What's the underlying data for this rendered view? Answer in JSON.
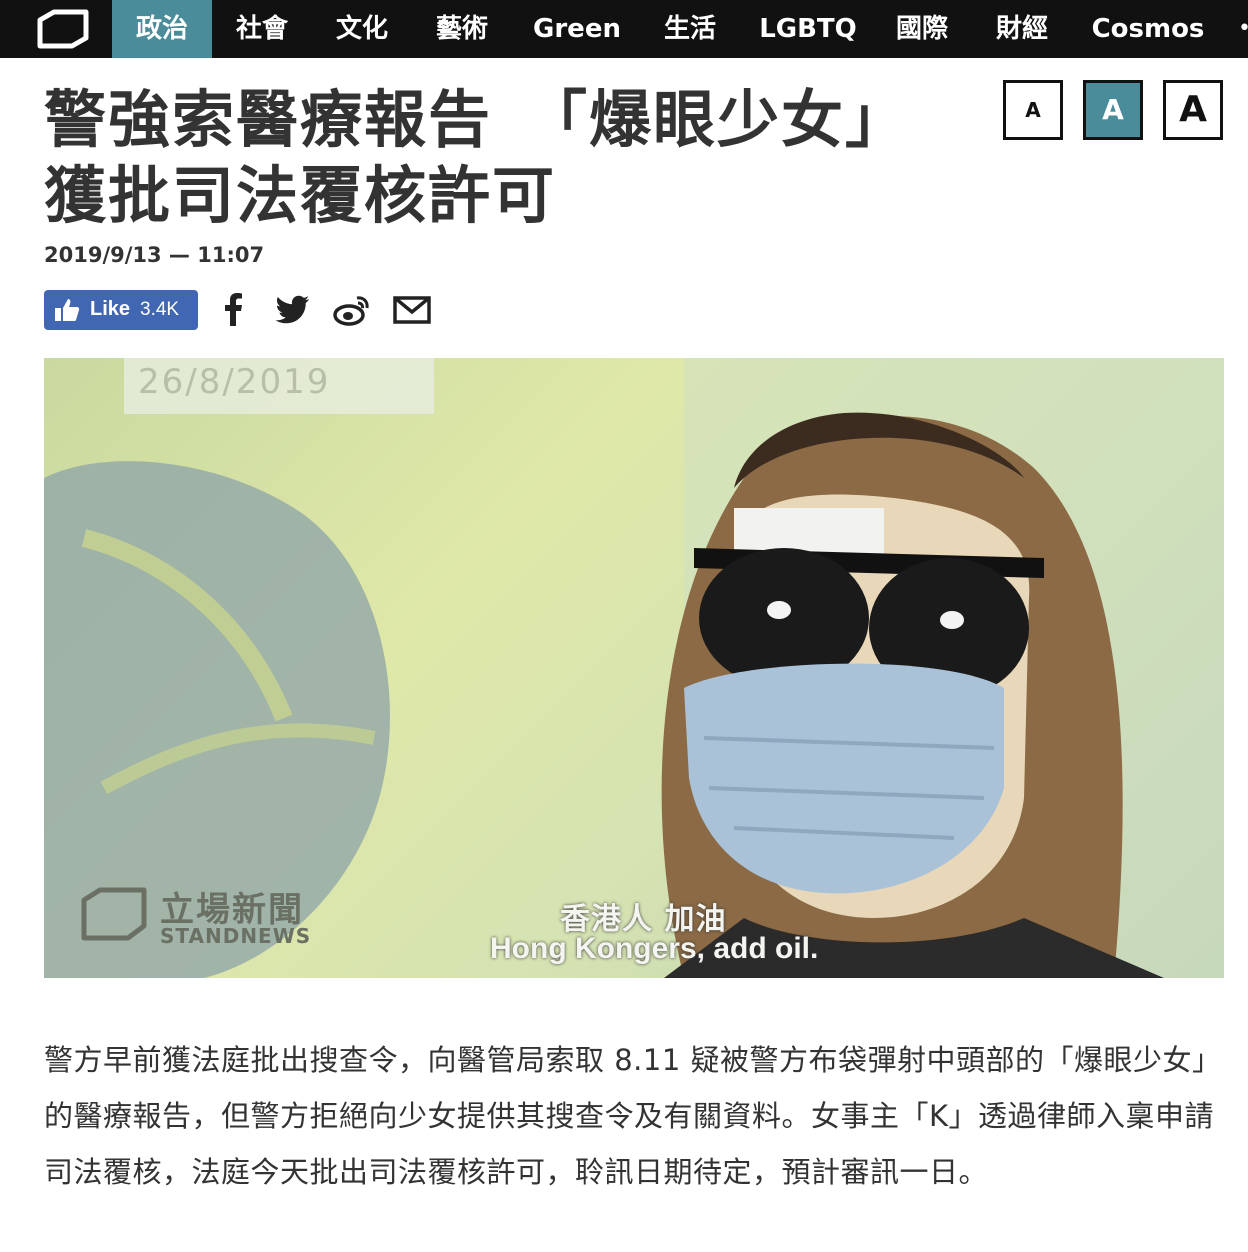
{
  "nav": {
    "items": [
      {
        "label": "政治",
        "active": true
      },
      {
        "label": "社會",
        "active": false
      },
      {
        "label": "文化",
        "active": false
      },
      {
        "label": "藝術",
        "active": false
      },
      {
        "label": "Green",
        "active": false
      },
      {
        "label": "生活",
        "active": false
      },
      {
        "label": "LGBTQ",
        "active": false
      },
      {
        "label": "國際",
        "active": false
      },
      {
        "label": "財經",
        "active": false
      },
      {
        "label": "Cosmos",
        "active": false
      }
    ],
    "accent_color": "#4a8c9a",
    "logo_icon": "cube-outline-icon"
  },
  "article": {
    "title": "警強索醫療報告　「爆眼少女」獲批司法覆核許可",
    "date": "2019/9/13 — 11:07",
    "body": "警方早前獲法庭批出搜查令，向醫管局索取 8.11 疑被警方布袋彈射中頭部的「爆眼少女」的醫療報告，但警方拒絕向少女提供其搜查令及有關資料。女事主「K」透過律師入稟申請司法覆核，法庭今天批出司法覆核許可，聆訊日期待定，預計審訊一日。"
  },
  "font_size_buttons": [
    {
      "label": "A",
      "active": false
    },
    {
      "label": "A",
      "active": true
    },
    {
      "label": "A",
      "active": false
    }
  ],
  "social": {
    "like_label": "Like",
    "like_count": "3.4K",
    "icons": [
      "facebook-icon",
      "twitter-icon",
      "weibo-icon",
      "email-icon"
    ]
  },
  "hero": {
    "stamp_text": "26/8/2019",
    "watermark_cn": "立場新聞",
    "watermark_en": "STANDNEWS",
    "subtitle_cn": "香港人 加油",
    "subtitle_en": "Hong Kongers, add oil."
  }
}
